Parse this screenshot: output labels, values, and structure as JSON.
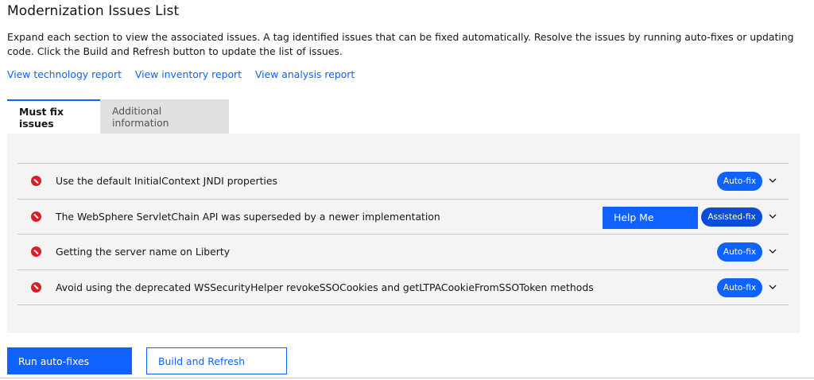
{
  "page": {
    "title": "Modernization Issues List",
    "description": "Expand each section to view the associated issues. A tag identified issues that can be fixed automatically. Resolve the issues by running auto-fixes or updating code. Click the Build and Refresh button to update the list of issues."
  },
  "links": {
    "technology": "View technology report",
    "inventory": "View inventory report",
    "analysis": "View analysis report"
  },
  "tabs": {
    "must_fix": "Must fix issues",
    "additional": "Additional information"
  },
  "issues": [
    {
      "icon": "error-icon",
      "text": "Use the default InitialContext JNDI properties",
      "tag": "Auto-fix"
    },
    {
      "icon": "error-icon",
      "text": "The WebSphere ServletChain API was superseded by a newer implementation",
      "tag": "Assisted-fix",
      "help": "Help Me"
    },
    {
      "icon": "error-icon",
      "text": "Getting the server name on Liberty",
      "tag": "Auto-fix"
    },
    {
      "icon": "error-icon",
      "text": "Avoid using the deprecated WSSecurityHelper revokeSSOCookies and getLTPACookieFromSSOToken methods",
      "tag": "Auto-fix"
    }
  ],
  "buttons": {
    "run_autofixes": "Run auto-fixes",
    "build_refresh": "Build and Refresh"
  },
  "colors": {
    "accent": "#0f62fe",
    "error": "#da1e28",
    "panel": "#f4f4f4"
  }
}
